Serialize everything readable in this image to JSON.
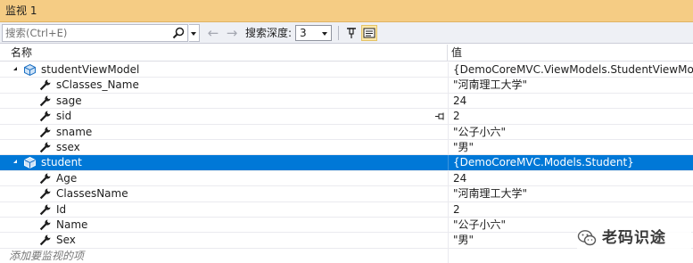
{
  "window": {
    "title": "监视 1"
  },
  "toolbar": {
    "search_placeholder": "搜索(Ctrl+E)",
    "depth_label": "搜索深度:",
    "depth_value": "3"
  },
  "columns": {
    "name": "名称",
    "value": "值"
  },
  "rows": [
    {
      "name": "studentViewModel",
      "value": "{DemoCoreMVC.ViewModels.StudentViewModel}",
      "icon": "object-icon",
      "expanded": true
    },
    {
      "name": "sClasses_Name",
      "value": "\"河南理工大学\"",
      "icon": "wrench-icon"
    },
    {
      "name": "sage",
      "value": "24",
      "icon": "wrench-icon"
    },
    {
      "name": "sid",
      "value": "2",
      "icon": "wrench-icon"
    },
    {
      "name": "sname",
      "value": "\"公子小六\"",
      "icon": "wrench-icon"
    },
    {
      "name": "ssex",
      "value": "\"男\"",
      "icon": "wrench-icon"
    },
    {
      "name": "student",
      "value": "{DemoCoreMVC.Models.Student}",
      "icon": "object-icon",
      "expanded": true,
      "selected": true
    },
    {
      "name": "Age",
      "value": "24",
      "icon": "wrench-icon"
    },
    {
      "name": "ClassesName",
      "value": "\"河南理工大学\"",
      "icon": "wrench-icon"
    },
    {
      "name": "Id",
      "value": "2",
      "icon": "wrench-icon"
    },
    {
      "name": "Name",
      "value": "\"公子小六\"",
      "icon": "wrench-icon"
    },
    {
      "name": "Sex",
      "value": "\"男\"",
      "icon": "wrench-icon"
    }
  ],
  "add_watch_placeholder": "添加要监视的项",
  "watermark": {
    "text": "老码识途"
  },
  "colors": {
    "title_bar": "#f5cc84",
    "selection": "#0078d7",
    "toolbar": "#eef0f5"
  }
}
